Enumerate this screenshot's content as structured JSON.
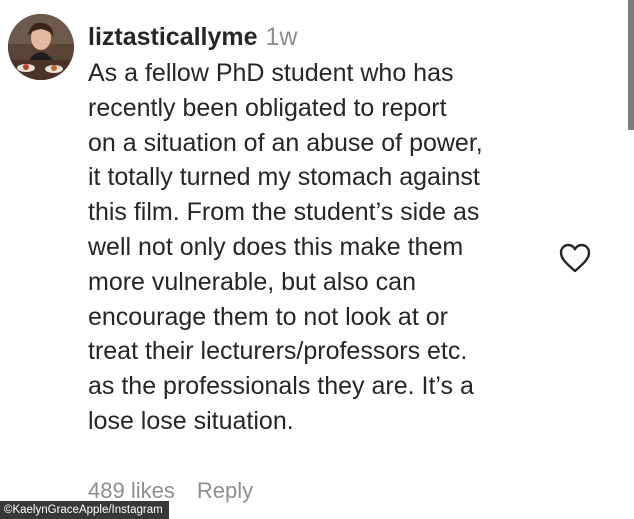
{
  "comment": {
    "username": "liztasticallyme",
    "time": "1w",
    "lines": [
      "As a fellow PhD student who has",
      "recently been obligated to report",
      "on a situation of an abuse of power,",
      "it totally turned my stomach against",
      "this film. From the student’s side as",
      "well not only does this make them",
      "more vulnerable, but also can",
      "encourage them to not look at or",
      "treat their lecturers/professors etc.",
      "as the professionals they are. It’s a",
      "lose lose situation."
    ],
    "likes": "489 likes",
    "reply": "Reply",
    "like_icon": "heart-outline-icon"
  },
  "credit": "©KaelynGraceApple/Instagram",
  "colors": {
    "text": "#262626",
    "muted": "#8e8e8e",
    "background": "#ffffff"
  }
}
